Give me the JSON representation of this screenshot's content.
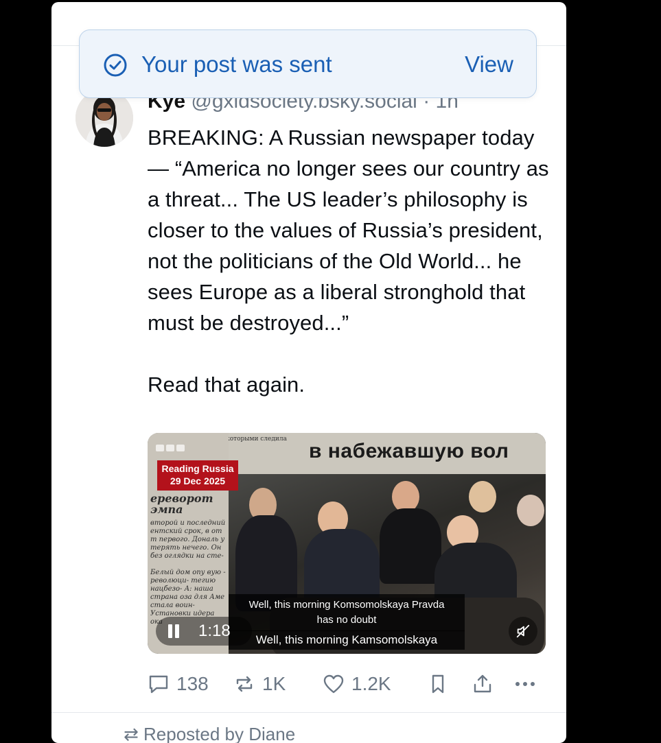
{
  "toast": {
    "message": "Your post was sent",
    "action_label": "View"
  },
  "post": {
    "author_name": "Kye",
    "handle": "@gxldsociety.bsky.social",
    "separator": "·",
    "time": "1h",
    "text": "BREAKING: A Russian newspaper today — “America no longer sees our country as a threat... The US leader’s philosophy is closer to the values of Russia’s president, not the politicians of the Old World... he sees Europe as a liberal stronghold that must be destroyed...”\n\nRead that again.",
    "video": {
      "badge_line1": "Reading Russia",
      "badge_line2": "29 Dec 2025",
      "newspaper_headline": "в набежавшую вол",
      "newspaper_small": "Пять тенденций, за которыми следила весь мир.",
      "newspaper_subhead": "ереворот\nэмпа",
      "newspaper_column": "второй и последний ентский срок, в от т первого. Дональ у терять нечего. Он без оглядки на сте-\n\nБелый дом опу вую - революци- тегию нацбезо- А: наша страна оза для Аме стала воин- Установки идера ока",
      "caption_line1": "Well, this morning Komsomolskaya Pravda",
      "caption_line2": "has no doubt",
      "caption_burned": "Well, this morning Kamsomolskaya",
      "duration": "1:18"
    },
    "actions": {
      "replies": "138",
      "reposts": "1K",
      "likes": "1.2K"
    },
    "icons": {
      "reply": "reply-icon",
      "repost": "repost-icon",
      "like": "heart-icon",
      "bookmark": "bookmark-icon",
      "share": "share-icon",
      "more": "more-icon",
      "check": "check-circle-icon",
      "pause": "pause-icon",
      "mute": "mute-icon"
    }
  },
  "next_post": {
    "repost_label": "Reposted by Diane"
  },
  "colors": {
    "accent": "#1a5fb4",
    "toast_bg": "#eef4fb",
    "muted_text": "#6b7785",
    "badge_red": "#b3121b"
  }
}
